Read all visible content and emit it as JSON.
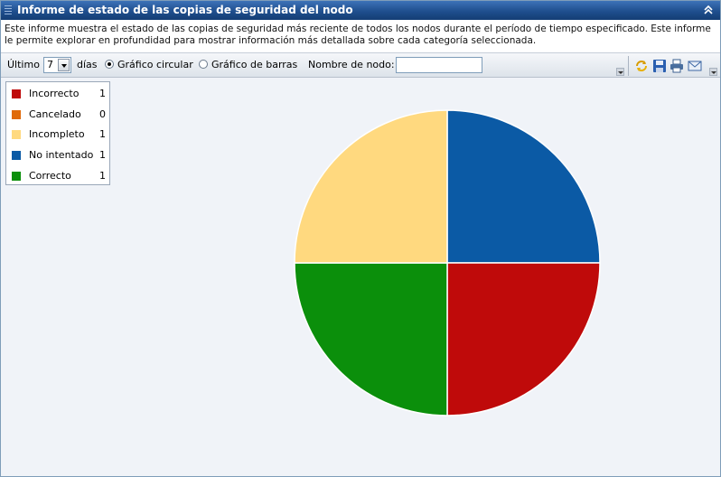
{
  "window": {
    "title": "Informe de estado de las copias de seguridad del nodo",
    "description": "Este informe muestra el estado de las copias de seguridad más reciente de todos los nodos durante el período de tiempo especificado. Este informe le permite explorar en profundidad para mostrar información más detallada sobre cada categoría seleccionada."
  },
  "toolbar": {
    "last_label": "Último",
    "days_value": "7",
    "days_label": "días",
    "pie_option": "Gráfico circular",
    "bar_option": "Gráfico de barras",
    "node_name_label": "Nombre de nodo:",
    "node_name_value": "",
    "selected_chart": "pie",
    "icons": [
      "refresh-icon",
      "save-icon",
      "print-icon",
      "email-icon"
    ]
  },
  "legend": {
    "items": [
      {
        "label": "Incorrecto",
        "count": "1",
        "color": "#bf0a0a"
      },
      {
        "label": "Cancelado",
        "count": "0",
        "color": "#e06a0a"
      },
      {
        "label": "Incompleto",
        "count": "1",
        "color": "#ffd97f"
      },
      {
        "label": "No intentado",
        "count": "1",
        "color": "#0b5aa5"
      },
      {
        "label": "Correcto",
        "count": "1",
        "color": "#0b8f0b"
      }
    ]
  },
  "chart_data": {
    "type": "pie",
    "categories": [
      "No intentado",
      "Incorrecto",
      "Correcto",
      "Incompleto",
      "Cancelado"
    ],
    "values": [
      1,
      1,
      1,
      1,
      0
    ],
    "colors": [
      "#0b5aa5",
      "#bf0a0a",
      "#0b8f0b",
      "#ffd97f",
      "#e06a0a"
    ],
    "title": "",
    "legend_position": "top-left"
  }
}
